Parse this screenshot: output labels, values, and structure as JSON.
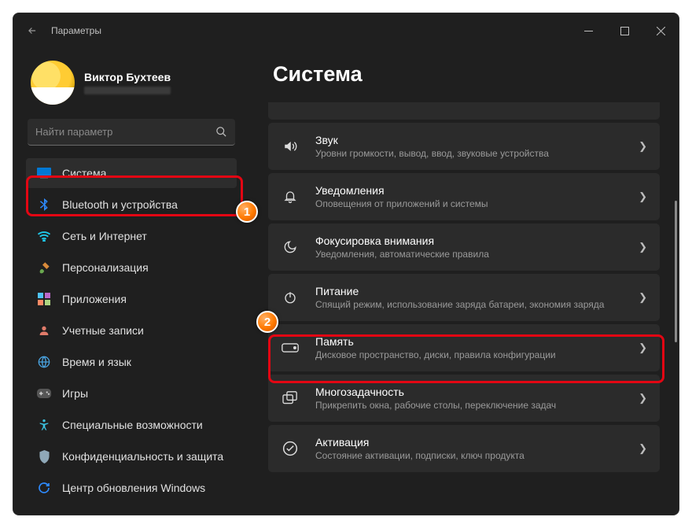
{
  "titlebar": {
    "app_title": "Параметры"
  },
  "profile": {
    "name": "Виктор Бухтеев"
  },
  "search": {
    "placeholder": "Найти параметр"
  },
  "sidebar": {
    "items": [
      {
        "label": "Система"
      },
      {
        "label": "Bluetooth и устройства"
      },
      {
        "label": "Сеть и Интернет"
      },
      {
        "label": "Персонализация"
      },
      {
        "label": "Приложения"
      },
      {
        "label": "Учетные записи"
      },
      {
        "label": "Время и язык"
      },
      {
        "label": "Игры"
      },
      {
        "label": "Специальные возможности"
      },
      {
        "label": "Конфиденциальность и защита"
      },
      {
        "label": "Центр обновления Windows"
      }
    ]
  },
  "main": {
    "heading": "Система",
    "cards": [
      {
        "title": "Звук",
        "desc": "Уровни громкости, вывод, ввод, звуковые устройства"
      },
      {
        "title": "Уведомления",
        "desc": "Оповещения от приложений и системы"
      },
      {
        "title": "Фокусировка внимания",
        "desc": "Уведомления, автоматические правила"
      },
      {
        "title": "Питание",
        "desc": "Спящий режим, использование заряда батареи, экономия заряда"
      },
      {
        "title": "Память",
        "desc": "Дисковое пространство, диски, правила конфигурации"
      },
      {
        "title": "Многозадачность",
        "desc": "Прикрепить окна, рабочие столы, переключение задач"
      },
      {
        "title": "Активация",
        "desc": "Состояние активации, подписки, ключ продукта"
      }
    ]
  },
  "annotations": {
    "badge1": "1",
    "badge2": "2"
  }
}
